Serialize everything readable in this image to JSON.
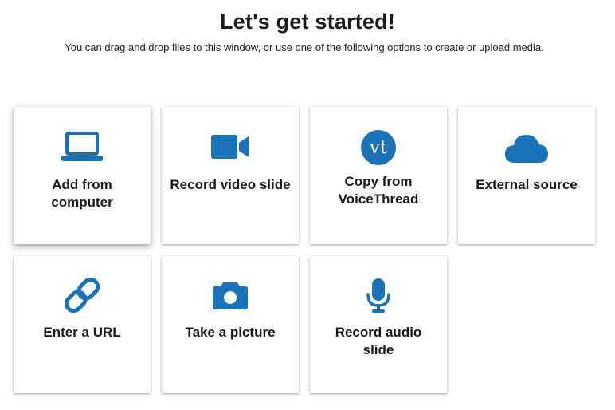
{
  "header": {
    "title": "Let's get started!",
    "subtitle": "You can drag and drop files to this window, or use one of the following options to create or upload media."
  },
  "accent_color": "#1a72b8",
  "options": [
    {
      "label": "Add from computer",
      "icon": "laptop-icon"
    },
    {
      "label": "Record video slide",
      "icon": "video-camera-icon"
    },
    {
      "label": "Copy from VoiceThread",
      "icon": "voicethread-logo-icon"
    },
    {
      "label": "External source",
      "icon": "cloud-icon"
    },
    {
      "label": "Enter a URL",
      "icon": "link-icon"
    },
    {
      "label": "Take a picture",
      "icon": "camera-icon"
    },
    {
      "label": "Record audio slide",
      "icon": "microphone-icon"
    }
  ]
}
